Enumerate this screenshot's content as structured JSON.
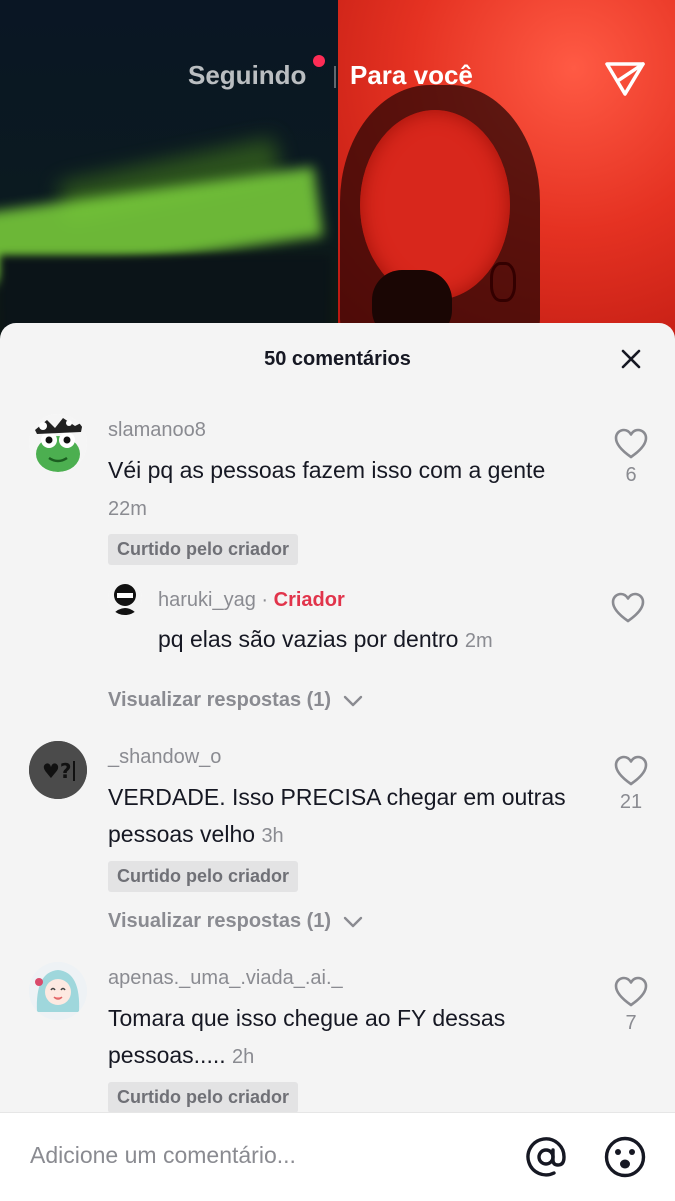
{
  "nav": {
    "following_label": "Seguindo",
    "foryou_label": "Para você"
  },
  "sheet": {
    "title": "50 comentários",
    "comments": [
      {
        "username": "slamanoo8",
        "text": "Véi pq as pessoas fazem isso com a gente",
        "time": "22m",
        "likes": "6",
        "badge": "Curtido pelo criador",
        "reply": {
          "username": "haruki_yag",
          "separator": "·",
          "creator_label": "Criador",
          "text": "pq elas são vazias por dentro",
          "time": "2m"
        },
        "view_replies": "Visualizar respostas (1)"
      },
      {
        "username": "_shandow_o",
        "text": "VERDADE. Isso PRECISA chegar em outras pessoas velho",
        "time": "3h",
        "likes": "21",
        "badge": "Curtido pelo criador",
        "view_replies": "Visualizar respostas (1)"
      },
      {
        "username": "apenas._uma_.viada_.ai._",
        "text": "Tomara que isso chegue ao FY dessas pessoas.....",
        "time": "2h",
        "likes": "7",
        "badge": "Curtido pelo criador"
      }
    ]
  },
  "input": {
    "placeholder": "Adicione um comentário..."
  },
  "colors": {
    "accent_red": "#fe2c55",
    "creator_red": "#e1344b",
    "sheet_bg": "#f4f4f4"
  },
  "icons": [
    "send-icon",
    "close-icon",
    "heart-icon",
    "chevron-down-icon",
    "at-icon",
    "emoji-icon"
  ]
}
